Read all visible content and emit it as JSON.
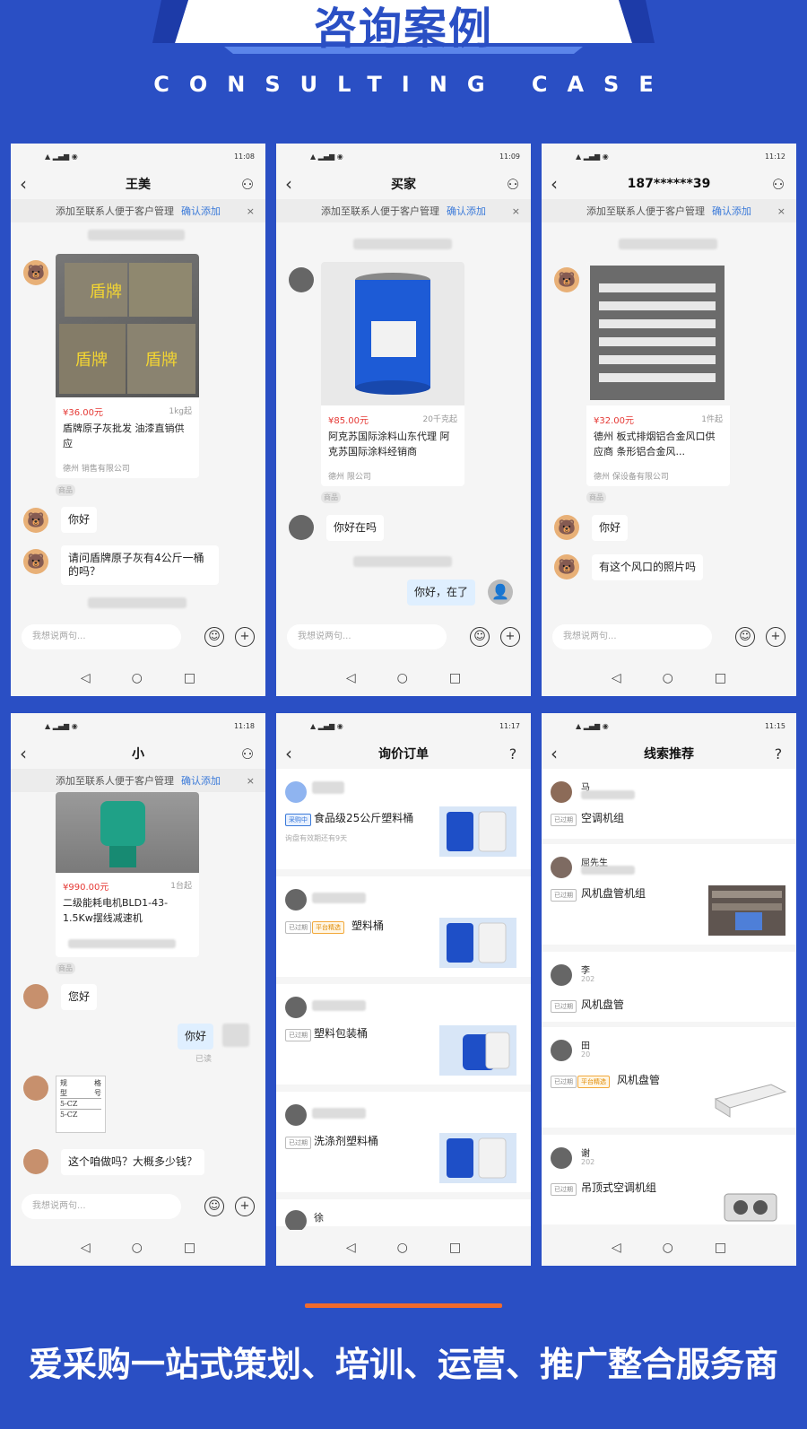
{
  "header": {
    "title": "咨询案例",
    "subtitle": "CONSULTING CASE"
  },
  "common": {
    "notice_text": "添加至联系人便于客户管理",
    "notice_link": "确认添加",
    "notice_close": "×",
    "input_placeholder": "我想说两句...",
    "emoji_icon": "☺",
    "plus_icon": "+",
    "back_glyph": "‹",
    "tag": "商品",
    "nav_back": "◁",
    "nav_home": "○",
    "nav_recent": "□"
  },
  "phones": [
    {
      "time": "11:08",
      "title": "王美",
      "card": {
        "price": "¥36.00元",
        "moq": "1kg起",
        "title": "盾牌原子灰批发 油漆直销供应",
        "company": "德州 销售有限公司",
        "brand": "盾牌"
      },
      "messages": [
        "你好",
        "请问盾牌原子灰有4公斤一桶的吗？"
      ]
    },
    {
      "time": "11:09",
      "title": "买家",
      "card": {
        "price": "¥85.00元",
        "moq": "20千克起",
        "title": "阿克苏国际涂料山东代理 阿克苏国际涂料经销商",
        "company": "德州 限公司"
      },
      "messages": [
        "你好在吗",
        "你好，在了"
      ]
    },
    {
      "time": "11:12",
      "title": "187******39",
      "card": {
        "price": "¥32.00元",
        "moq": "1件起",
        "title": "德州 板式排烟铝合金风口供应商 条形铝合金风...",
        "company": "德州 保设备有限公司"
      },
      "messages": [
        "你好",
        "有这个风口的照片吗"
      ]
    },
    {
      "time": "11:18",
      "title": "小",
      "card": {
        "price": "¥990.00元",
        "moq": "1台起",
        "title": "二级能耗电机BLD1-43-1.5Kw摆线减速机",
        "company": ""
      },
      "messages": [
        "您好",
        "你好",
        "已读",
        "这个咱做吗？大概多少钱？"
      ],
      "spec": [
        "规",
        "格",
        "型",
        "号",
        "5-CZ",
        "5-CZ"
      ]
    },
    {
      "time": "11:17",
      "title": "询价订单",
      "items": [
        {
          "title": "食品级25公斤塑料桶",
          "badge": "采购中",
          "sub": "询盘有效期还有9天"
        },
        {
          "title": "塑料桶",
          "badge": "已过期",
          "badge2": "平台精选"
        },
        {
          "title": "塑料包装桶",
          "badge": "已过期"
        },
        {
          "title": "洗涤剂塑料桶",
          "badge": "已过期"
        },
        {
          "name": "徐"
        }
      ]
    },
    {
      "time": "11:15",
      "title": "线索推荐",
      "items": [
        {
          "name": "马",
          "title": "空调机组",
          "badge": "已过期"
        },
        {
          "name": "屈先生",
          "title": "风机盘管机组",
          "badge": "已过期"
        },
        {
          "name": "李",
          "date": "202",
          "title": "风机盘管",
          "badge": "已过期"
        },
        {
          "name": "田",
          "date": "20",
          "title": "风机盘管",
          "badge": "已过期",
          "badge2": "平台精选"
        },
        {
          "name": "谢",
          "date": "202",
          "title": "吊顶式空调机组",
          "badge": "已过期"
        }
      ]
    }
  ],
  "footer": {
    "slogan": "爱采购一站式策划、培训、运营、推广整合服务商"
  },
  "colors": {
    "background": "#2a4fc4",
    "accent_line": "#f06a2d",
    "link": "#3b7ad9",
    "price": "#e53935"
  }
}
